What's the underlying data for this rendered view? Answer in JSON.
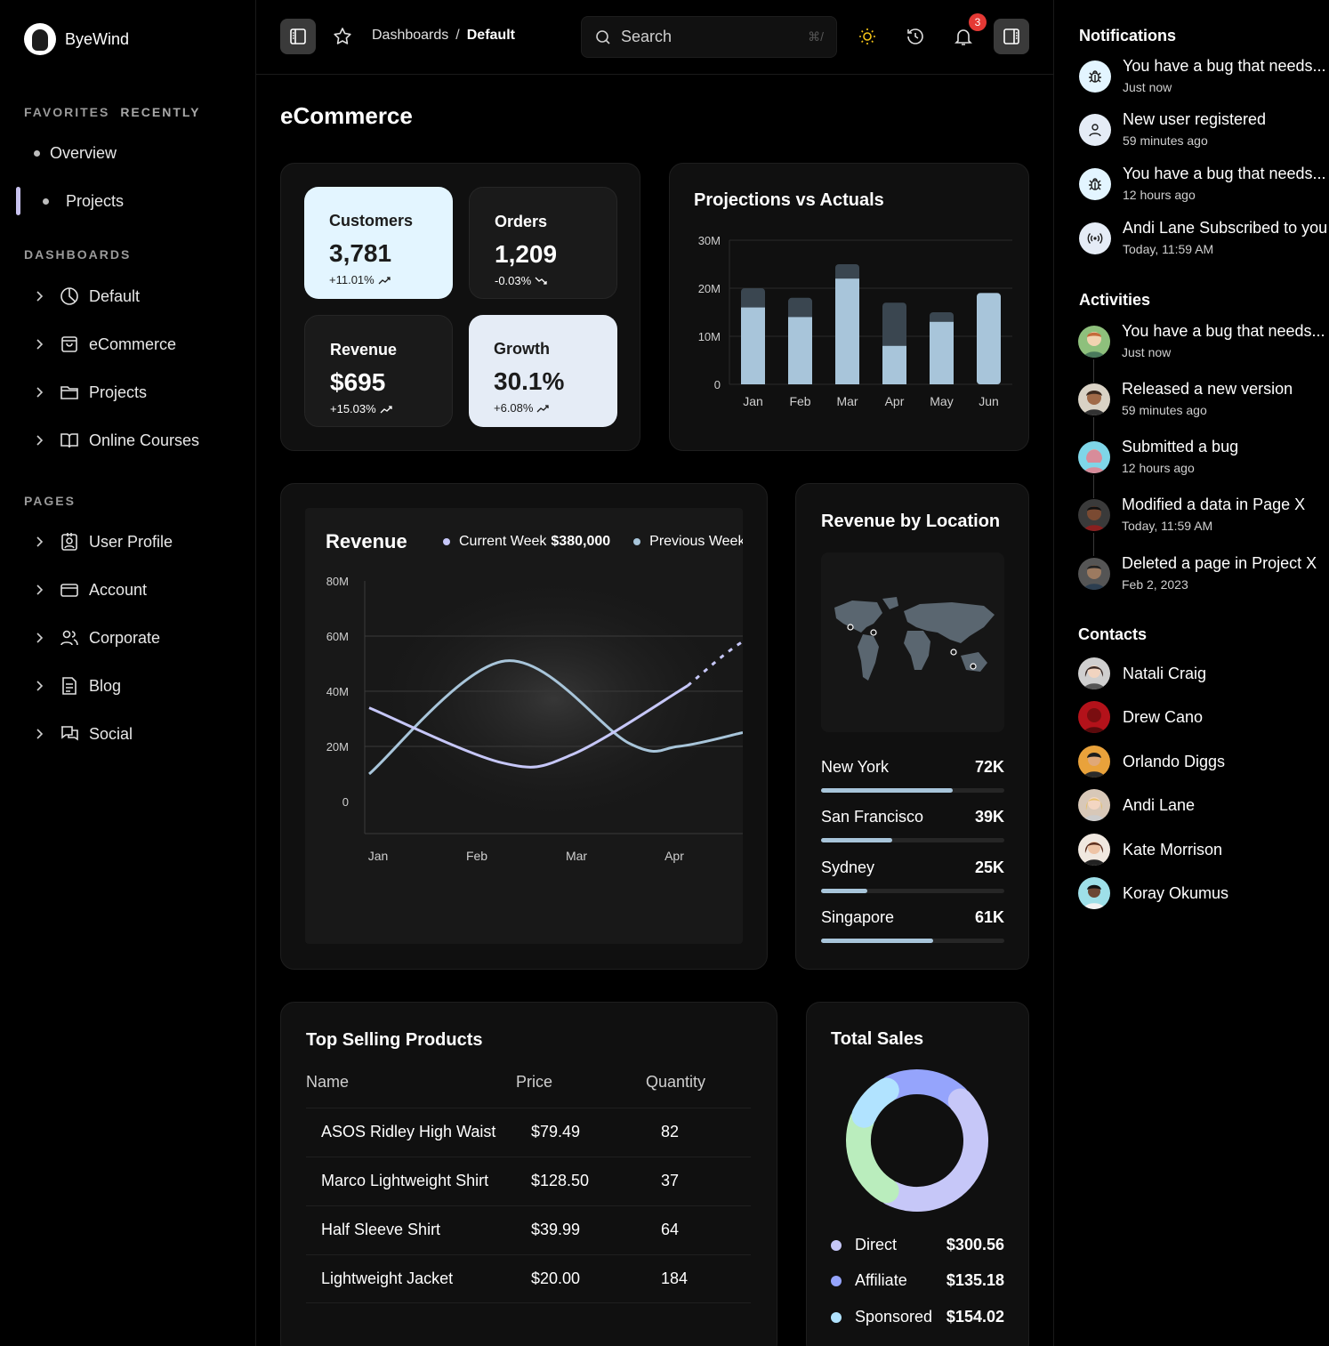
{
  "app": {
    "brand": "ByeWind"
  },
  "sidebar": {
    "tabs": [
      "FAVORITES",
      "RECENTLY"
    ],
    "favorites": [
      "Overview",
      "Projects"
    ],
    "dashboards_title": "DASHBOARDS",
    "dashboards": [
      {
        "label": "Default",
        "icon": "pie-chart-icon"
      },
      {
        "label": "eCommerce",
        "icon": "shopping-bag-icon"
      },
      {
        "label": "Projects",
        "icon": "folder-icon"
      },
      {
        "label": "Online Courses",
        "icon": "book-icon"
      }
    ],
    "pages_title": "PAGES",
    "pages": [
      {
        "label": "User Profile",
        "icon": "id-badge-icon"
      },
      {
        "label": "Account",
        "icon": "credit-card-icon"
      },
      {
        "label": "Corporate",
        "icon": "users-icon"
      },
      {
        "label": "Blog",
        "icon": "document-icon"
      },
      {
        "label": "Social",
        "icon": "chat-icon"
      }
    ]
  },
  "topbar": {
    "breadcrumb": [
      "Dashboards",
      "/",
      "Default"
    ],
    "search_placeholder": "Search",
    "search_shortcut": "⌘/",
    "notification_count": "3"
  },
  "page": {
    "title": "eCommerce"
  },
  "kpis": [
    {
      "label": "Customers",
      "value": "3,781",
      "change": "+11.01%",
      "trend": "up"
    },
    {
      "label": "Orders",
      "value": "1,209",
      "change": "-0.03%",
      "trend": "down"
    },
    {
      "label": "Revenue",
      "value": "$695",
      "change": "+15.03%",
      "trend": "up"
    },
    {
      "label": "Growth",
      "value": "30.1%",
      "change": "+6.08%",
      "trend": "up"
    }
  ],
  "projections": {
    "title": "Projections vs Actuals",
    "ticks": [
      "30M",
      "20M",
      "10M",
      "0"
    ]
  },
  "revenue": {
    "title": "Revenue",
    "legend": [
      {
        "label": "Current Week",
        "value": "$380,000",
        "color": "#c6c7f8"
      },
      {
        "label": "Previous Week",
        "value": "",
        "color": "#a8c5da"
      }
    ],
    "ticks": [
      "80M",
      "60M",
      "40M",
      "20M",
      "0"
    ],
    "months": [
      "Jan",
      "Feb",
      "Mar",
      "Apr"
    ]
  },
  "location": {
    "title": "Revenue by Location",
    "rows": [
      {
        "city": "New York",
        "value": "72K",
        "level": 0.72
      },
      {
        "city": "San Francisco",
        "value": "39K",
        "level": 0.39
      },
      {
        "city": "Sydney",
        "value": "25K",
        "level": 0.25
      },
      {
        "city": "Singapore",
        "value": "61K",
        "level": 0.61
      }
    ]
  },
  "products": {
    "title": "Top Selling Products",
    "columns": [
      "Name",
      "Price",
      "Quantity"
    ],
    "rows": [
      [
        "ASOS Ridley High Waist",
        "$79.49",
        "82"
      ],
      [
        "Marco Lightweight Shirt",
        "$128.50",
        "37"
      ],
      [
        "Half Sleeve Shirt",
        "$39.99",
        "64"
      ],
      [
        "Lightweight Jacket",
        "$20.00",
        "184"
      ]
    ]
  },
  "total_sales": {
    "title": "Total Sales",
    "items": [
      {
        "label": "Direct",
        "value": "$300.56",
        "color": "#c6c7f8"
      },
      {
        "label": "Affiliate",
        "value": "$135.18",
        "color": "#95a4fc"
      },
      {
        "label": "Sponsored",
        "value": "$154.02",
        "color": "#b1e3ff"
      }
    ]
  },
  "notifications": {
    "title": "Notifications",
    "items": [
      {
        "text": "You have a bug that needs...",
        "time": "Just now",
        "icon": "bug-icon"
      },
      {
        "text": "New user registered",
        "time": "59 minutes ago",
        "icon": "user-icon"
      },
      {
        "text": "You have a bug that needs...",
        "time": "12 hours ago",
        "icon": "bug-icon"
      },
      {
        "text": "Andi Lane Subscribed to you",
        "time": "Today, 11:59 AM",
        "icon": "broadcast-icon"
      }
    ]
  },
  "activities": {
    "title": "Activities",
    "items": [
      {
        "text": "You have a bug that needs...",
        "time": "Just now"
      },
      {
        "text": "Released a new version",
        "time": "59 minutes ago"
      },
      {
        "text": "Submitted a bug",
        "time": "12 hours ago"
      },
      {
        "text": "Modified a data in Page X",
        "time": "Today, 11:59 AM"
      },
      {
        "text": "Deleted a page in Project X",
        "time": "Feb 2, 2023"
      }
    ]
  },
  "contacts": {
    "title": "Contacts",
    "items": [
      "Natali Craig",
      "Drew Cano",
      "Orlando Diggs",
      "Andi Lane",
      "Kate Morrison",
      "Koray Okumus"
    ]
  },
  "chart_data": [
    {
      "type": "bar",
      "title": "Projections vs Actuals",
      "categories": [
        "Jan",
        "Feb",
        "Mar",
        "Apr",
        "May",
        "Jun"
      ],
      "series": [
        {
          "values": [
            16,
            14,
            22,
            8,
            13,
            19
          ]
        },
        {
          "values": [
            20,
            18,
            25,
            17,
            15,
            19
          ]
        }
      ],
      "ylim": [
        0,
        30
      ],
      "unit": "M",
      "grid": true
    },
    {
      "type": "line",
      "title": "Revenue",
      "x": [
        "Jan",
        "Feb",
        "Mar",
        "Apr"
      ],
      "series": [
        {
          "name": "Current Week",
          "values": [
            34,
            14,
            16,
            42
          ],
          "color": "#c6c7f8"
        },
        {
          "name": "Previous Week",
          "values": [
            10,
            51,
            30,
            21
          ],
          "color": "#a8c5da"
        }
      ],
      "ylim": [
        0,
        80
      ],
      "unit": "M",
      "grid": true
    },
    {
      "type": "pie",
      "title": "Total Sales",
      "categories": [
        "Direct",
        "Affiliate",
        "Sponsored"
      ],
      "values": [
        300.56,
        135.18,
        154.02
      ]
    }
  ]
}
